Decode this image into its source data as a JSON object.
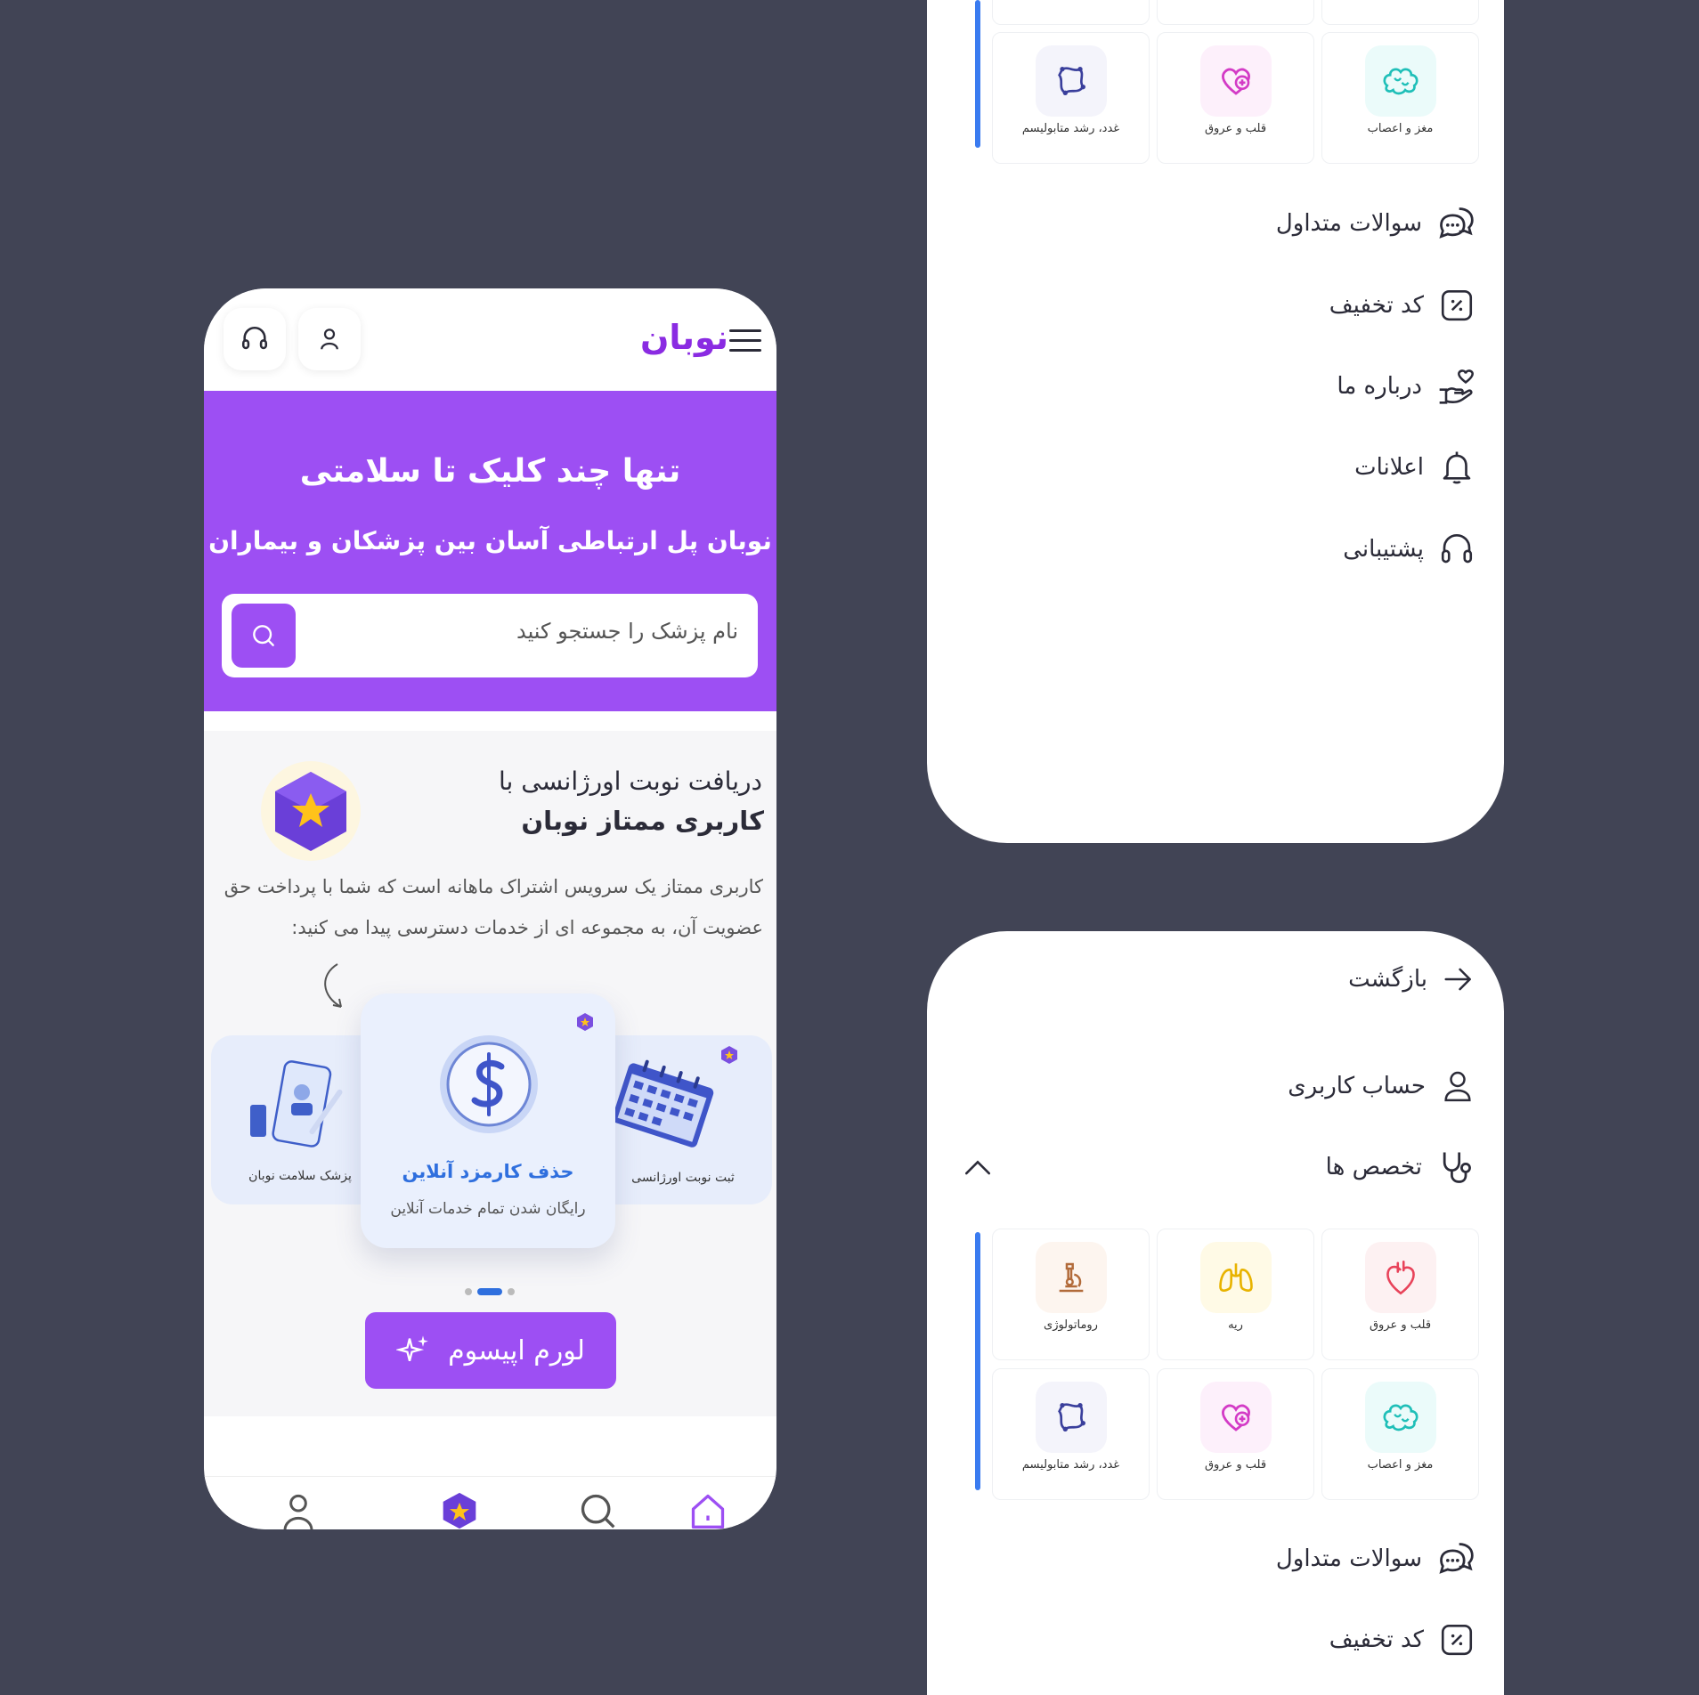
{
  "phone": {
    "logo": "نوبان",
    "hero_title": "تنها چند کلیک تا سلامتی",
    "hero_subtitle": "نوبان پل ارتباطی آسان بین پزشکان و بیماران",
    "search_placeholder": "نام پزشک را جستجو کنید",
    "promo_line1": "دریافت نوبت اورژانسی با",
    "promo_line2": "کاربری ممتاز نوبان",
    "promo_desc": "کاربری ممتاز یک سرویس اشتراک ماهانه است که شما با پرداخت حق عضویت آن، به مجموعه ای از خدمات دسترسی پیدا می کنید:",
    "card_left_label": "پزشک سلامت نوبان",
    "card_main_title": "حذف کارمزد آنلاین",
    "card_main_sub": "رایگان شدن تمام خدمات آنلاین",
    "card_right_label": "ثبت نوبت اورژانسی",
    "cta_label": "لورم اپیسوم",
    "colors": {
      "primary": "#9d4ff3",
      "accent_blue": "#3a7bf0",
      "background": "#414455"
    }
  },
  "panel1": {
    "tiles": [
      {
        "label": "غدد، رشد متابولیسم",
        "icon": "gland-icon"
      },
      {
        "label": "قلب و عروق",
        "icon": "heart-plus-icon"
      },
      {
        "label": "مغز و اعصاب",
        "icon": "brain-icon"
      }
    ],
    "menu": [
      {
        "label": "سوالات متداول",
        "icon": "chat-bubbles-icon"
      },
      {
        "label": "کد تخفیف",
        "icon": "discount-icon"
      },
      {
        "label": "درباره ما",
        "icon": "hand-heart-icon"
      },
      {
        "label": "اعلانات",
        "icon": "bell-icon"
      },
      {
        "label": "پشتیبانی",
        "icon": "headset-icon"
      }
    ]
  },
  "panel2": {
    "back": "بازگشت",
    "account": "حساب کاربری",
    "specialties": "تخصص ها",
    "tiles_row1": [
      {
        "label": "روماتولوژی",
        "icon": "microscope-icon"
      },
      {
        "label": "ریه",
        "icon": "lungs-icon"
      },
      {
        "label": "قلب و عروق",
        "icon": "heart-icon"
      }
    ],
    "tiles_row2": [
      {
        "label": "غدد، رشد متابولیسم",
        "icon": "gland-icon"
      },
      {
        "label": "قلب و عروق",
        "icon": "heart-plus-icon"
      },
      {
        "label": "مغز و اعصاب",
        "icon": "brain-icon"
      }
    ],
    "menu": [
      {
        "label": "سوالات متداول",
        "icon": "chat-bubbles-icon"
      },
      {
        "label": "کد تخفیف",
        "icon": "discount-icon"
      }
    ]
  }
}
